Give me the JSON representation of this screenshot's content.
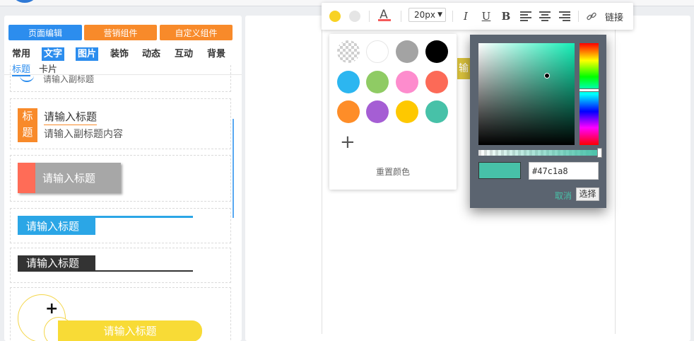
{
  "app": {
    "logo": "brand-logo"
  },
  "sidebar": {
    "buttons": {
      "page_edit": "页面编辑",
      "marketing": "营销组件",
      "custom": "自定义组件"
    },
    "categories": [
      "常用",
      "文字",
      "图片",
      "装饰",
      "动态",
      "互动",
      "背景"
    ],
    "active_categories": [
      "文字",
      "图片"
    ],
    "subtabs": [
      "标题",
      "卡片"
    ],
    "active_subtab": "标题",
    "items": {
      "partial_subtitle": "请输入副标题",
      "tag_chars": [
        "标",
        "题"
      ],
      "title": "请输入标题",
      "subtitle": "请输入副标题内容",
      "grey_title": "请输入标题",
      "blue_title": "请输入标题",
      "dark_title": "请输入标题",
      "yellow_title": "请输入标题",
      "plus": "+"
    }
  },
  "canvas": {
    "partial_text": "输"
  },
  "toolbar": {
    "bg_color": "#f8d223",
    "font_color_icon": "A",
    "font_size": "20px",
    "italic": "I",
    "underline": "U",
    "bold": "B",
    "link_label": "链接",
    "icons": [
      "text-color-dot-icon",
      "background-color-dot-icon",
      "font-color-icon",
      "italic-icon",
      "underline-icon",
      "bold-icon",
      "align-left-icon",
      "align-center-icon",
      "align-right-icon",
      "link-icon"
    ]
  },
  "swatches": {
    "colors": [
      "transparent",
      "#ffffff",
      "#a3a3a3",
      "#000000",
      "#2cb6f0",
      "#8fcb64",
      "#fd8ccd",
      "#fc6a57",
      "#fe8d28",
      "#a55ed4",
      "#fec800",
      "#47c1a8"
    ],
    "add": "+",
    "reset_label": "重置颜色"
  },
  "picker": {
    "hex": "#47c1a8",
    "current_color": "#47c1a8",
    "cancel_label": "取消",
    "choose_label": "选择"
  }
}
